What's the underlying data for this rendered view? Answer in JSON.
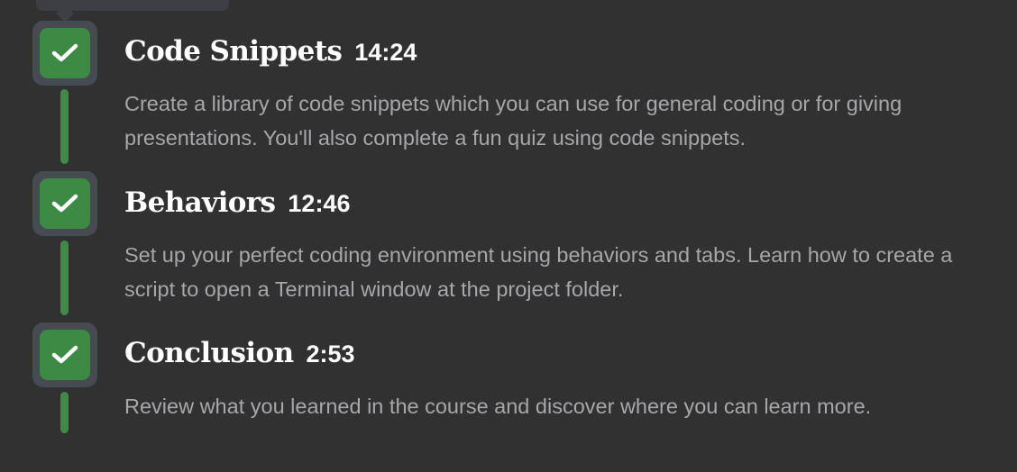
{
  "steps": [
    {
      "title": "Code Snippets",
      "duration": "14:24",
      "description": "Create a library of code snippets which you can use for general coding or for giving presentations. You'll also complete a fun quiz using code snippets.",
      "completed": true
    },
    {
      "title": "Behaviors",
      "duration": "12:46",
      "description": "Set up your perfect coding environment using behaviors and tabs. Learn how to create a script to open a Terminal window at the project folder.",
      "completed": true
    },
    {
      "title": "Conclusion",
      "duration": "2:53",
      "description": "Review what you learned in the course and discover where you can learn more.",
      "completed": true
    }
  ],
  "icons": {
    "status": "checkmark-icon"
  },
  "colors": {
    "background": "#313131",
    "check_fill": "#3d8a45",
    "check_ring": "#464a51",
    "connector": "#3f8b46",
    "title": "#ffffff",
    "description": "#a6a7ab"
  }
}
